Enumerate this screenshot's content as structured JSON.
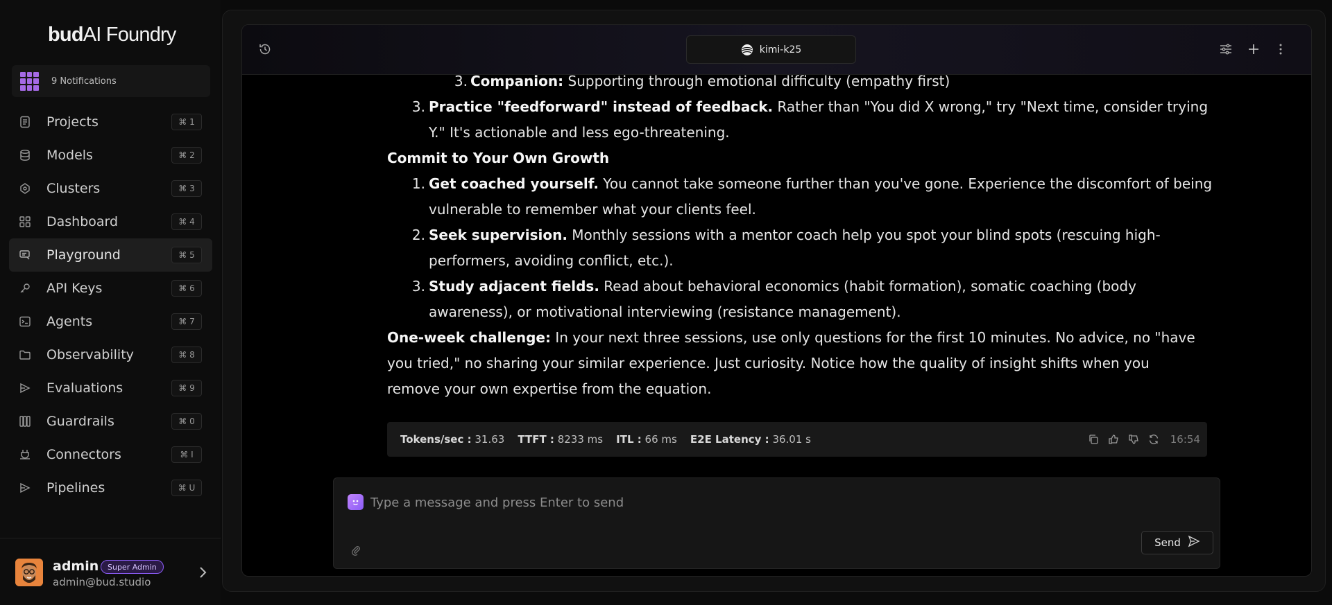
{
  "brand": {
    "bold": "bud",
    "rest": "AI Foundry"
  },
  "notifications": {
    "label": "9 Notifications",
    "accent": "#a56ae6"
  },
  "nav": [
    {
      "label": "Projects",
      "shortcut": "⌘ 1",
      "icon": "document-icon"
    },
    {
      "label": "Models",
      "shortcut": "⌘ 2",
      "icon": "database-icon"
    },
    {
      "label": "Clusters",
      "shortcut": "⌘ 3",
      "icon": "cluster-icon"
    },
    {
      "label": "Dashboard",
      "shortcut": "⌘ 4",
      "icon": "grid-icon"
    },
    {
      "label": "Playground",
      "shortcut": "⌘ 5",
      "icon": "playground-icon",
      "active": true
    },
    {
      "label": "API Keys",
      "shortcut": "⌘ 6",
      "icon": "key-icon"
    },
    {
      "label": "Agents",
      "shortcut": "⌘ 7",
      "icon": "terminal-icon"
    },
    {
      "label": "Observability",
      "shortcut": "⌘ 8",
      "icon": "folder-icon"
    },
    {
      "label": "Evaluations",
      "shortcut": "⌘ 9",
      "icon": "evaluation-icon"
    },
    {
      "label": "Guardrails",
      "shortcut": "⌘ 0",
      "icon": "guardrails-icon"
    },
    {
      "label": "Connectors",
      "shortcut": "⌘ I",
      "icon": "plug-icon"
    },
    {
      "label": "Pipelines",
      "shortcut": "⌘ U",
      "icon": "pipeline-icon"
    }
  ],
  "user": {
    "name": "admin",
    "role": "Super Admin",
    "email": "admin@bud.studio"
  },
  "chat": {
    "model": "kimi-k25",
    "message": {
      "companion": {
        "num": "3.",
        "bold": "Companion:",
        "text": " Supporting through emotional difficulty (empathy first)"
      },
      "feedforward": {
        "num": "3.",
        "bold": "Practice \"feedforward\" instead of feedback.",
        "text1": " Rather than \"You did X wrong,\" try \"Next time, consider trying",
        "text2": "Y.\" It's actionable and less ego-threatening."
      },
      "growth_heading": "Commit to Your Own Growth",
      "growth_items": [
        {
          "num": "1.",
          "bold": "Get coached yourself.",
          "text1": " You cannot take someone further than you've gone. Experience the discomfort of being",
          "text2": "vulnerable to remember what your clients feel."
        },
        {
          "num": "2.",
          "bold": "Seek supervision.",
          "text1": " Monthly sessions with a mentor coach help you spot your blind spots (rescuing high-",
          "text2": "performers, avoiding conflict, etc.)."
        },
        {
          "num": "3.",
          "bold": "Study adjacent fields.",
          "text1": " Read about behavioral economics (habit formation), somatic coaching (body",
          "text2": "awareness), or motivational interviewing (resistance management)."
        }
      ],
      "challenge": {
        "bold": "One-week challenge:",
        "text1": " In your next three sessions, use only questions for the first 10 minutes. No advice, no \"have",
        "text2": "you tried,\" no sharing your similar experience. Just curiosity. Notice how the quality of insight shifts when you",
        "text3": "remove your own expertise from the equation."
      }
    },
    "metrics": {
      "tokens_label": "Tokens/sec :",
      "tokens_value": "31.63",
      "ttft_label": "TTFT :",
      "ttft_value": "8233 ms",
      "itl_label": "ITL :",
      "itl_value": "66 ms",
      "e2e_label": "E2E Latency :",
      "e2e_value": "36.01 s",
      "time": "16:54"
    },
    "composer": {
      "placeholder": "Type a message and press Enter to send",
      "send_label": "Send"
    }
  }
}
